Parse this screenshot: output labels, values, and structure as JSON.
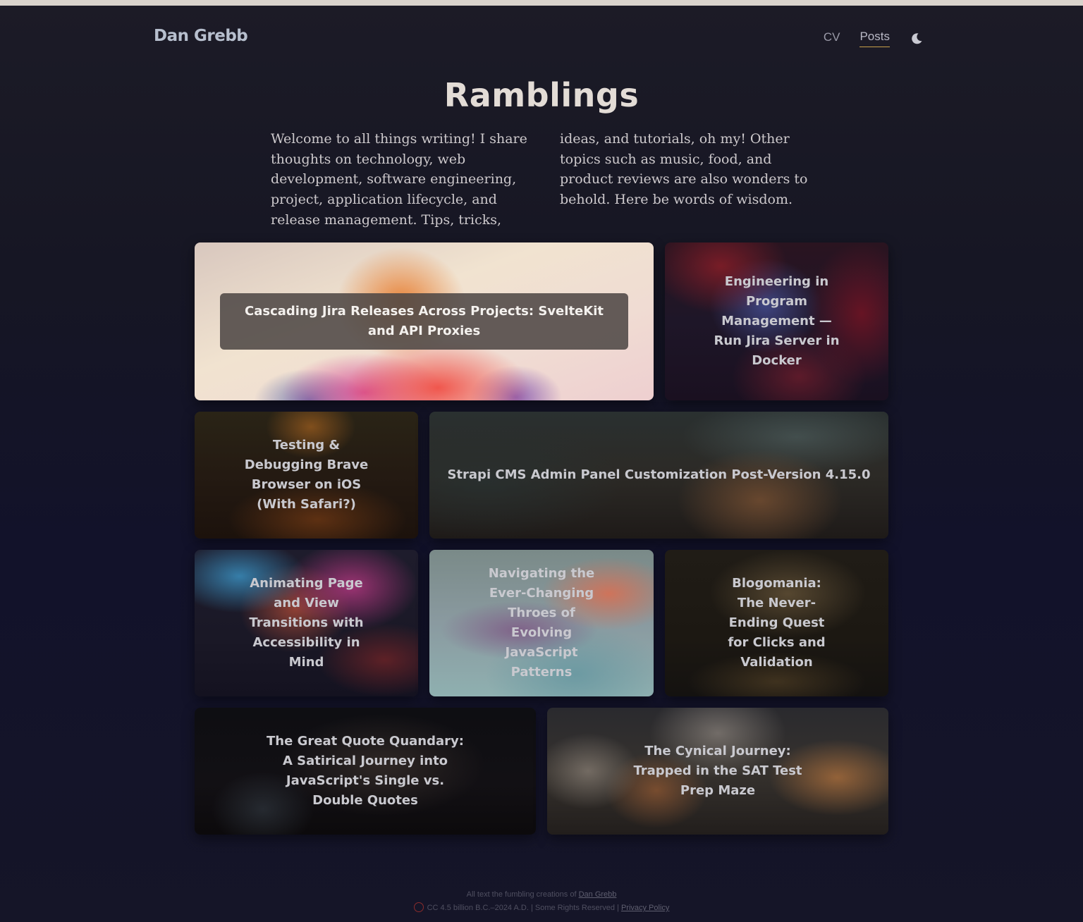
{
  "site": {
    "brand": "Dan Grebb",
    "nav": [
      {
        "label": "CV"
      },
      {
        "label": "Posts"
      }
    ],
    "theme_toggle_icon": "moon-icon"
  },
  "page": {
    "title": "Ramblings",
    "intro": "Welcome to all things writing! I share thoughts on technology, web development, software engineering, project, application lifecycle, and release management. Tips, tricks, ideas, and tutorials, oh my! Other topics such as music, food, and product reviews are also wonders to behold. Here be words of wisdom."
  },
  "posts": [
    {
      "title": "Cascading Jira Releases Across Projects: SvelteKit and API Proxies"
    },
    {
      "title": "Engineering in Program Management — Run Jira Server in Docker"
    },
    {
      "title": "Testing & Debugging Brave Browser on iOS (With Safari?)"
    },
    {
      "title": "Strapi CMS Admin Panel Customization Post-Version 4.15.0"
    },
    {
      "title": "Animating Page and View Transitions with Accessibility in Mind"
    },
    {
      "title": "Navigating the Ever-Changing Throes of Evolving JavaScript Patterns"
    },
    {
      "title": "Blogomania: The Never-Ending Quest for Clicks and Validation"
    },
    {
      "title": "The Great Quote Quandary: A Satirical Journey into JavaScript's Single vs. Double Quotes"
    },
    {
      "title": "The Cynical Journey: Trapped in the SAT Test Prep Maze"
    }
  ],
  "footer": {
    "line1_prefix": "All text the fumbling creations of ",
    "line1_link": "Dan Grebb",
    "line2_text": "CC 4.5 billion B.C.–2024 A.D. | Some Rights Reserved | ",
    "line2_link": "Privacy Policy",
    "license_icon": "creative-commons-icon"
  }
}
